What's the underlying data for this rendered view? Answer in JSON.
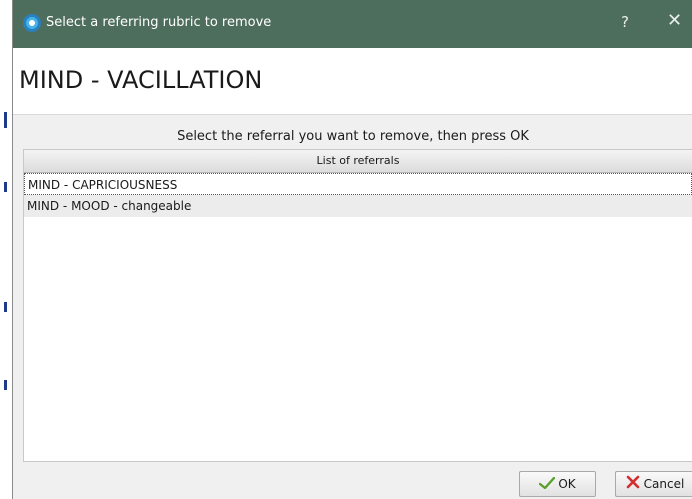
{
  "window": {
    "title": "Select a referring rubric to remove",
    "help_label": "?",
    "close_label": "✕"
  },
  "rubric": {
    "title": "MIND - VACILLATION"
  },
  "instructions": "Select the referral you want to remove, then press OK",
  "list": {
    "header": "List of referrals",
    "items": [
      {
        "label": "MIND - CAPRICIOUSNESS",
        "selected": true
      },
      {
        "label": "MIND - MOOD - changeable",
        "selected": false
      }
    ]
  },
  "buttons": {
    "ok_label": "OK",
    "cancel_label": "Cancel"
  },
  "colors": {
    "titlebar": "#4e6e5d",
    "ok_check": "#5aa02c",
    "cancel_x": "#d32f2f"
  },
  "icons": {
    "app": "app-logo-icon",
    "ok": "checkmark-icon",
    "cancel": "cross-icon"
  }
}
